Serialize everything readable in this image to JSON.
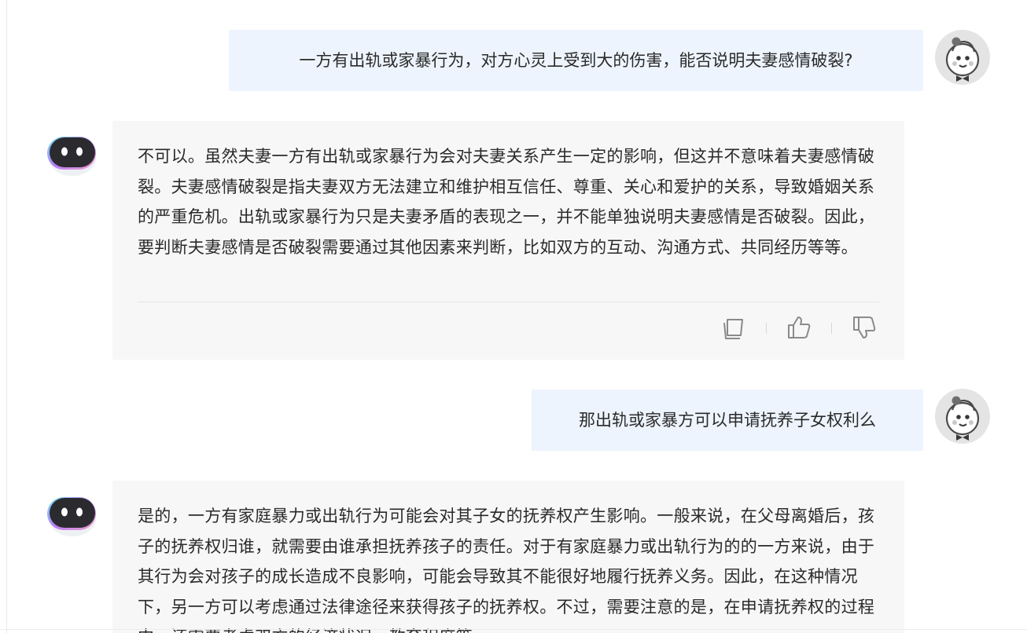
{
  "messages": [
    {
      "role": "user",
      "text": "一方有出轨或家暴行为，对方心灵上受到大的伤害，能否说明夫妻感情破裂?"
    },
    {
      "role": "assistant",
      "text": "不可以。虽然夫妻一方有出轨或家暴行为会对夫妻关系产生一定的影响，但这并不意味着夫妻感情破裂。夫妻感情破裂是指夫妻双方无法建立和维护相互信任、尊重、关心和爱护的关系，导致婚姻关系的严重危机。出轨或家暴行为只是夫妻矛盾的表现之一，并不能单独说明夫妻感情是否破裂。因此，要判断夫妻感情是否破裂需要通过其他因素来判断，比如双方的互动、沟通方式、共同经历等等。",
      "actions": [
        "copy-icon",
        "thumbs-up-icon",
        "thumbs-down-icon"
      ]
    },
    {
      "role": "user",
      "text": "那出轨或家暴方可以申请抚养子女权利么"
    },
    {
      "role": "assistant",
      "text": "是的，一方有家庭暴力或出轨行为可能会对其子女的抚养权产生影响。一般来说，在父母离婚后，孩子的抚养权归谁，就需要由谁承担抚养孩子的责任。对于有家庭暴力或出轨行为的的一方来说，由于其行为会对孩子的成长造成不良影响，可能会导致其不能很好地履行抚养义务。因此，在这种情况下，另一方可以考虑通过法律途径来获得孩子的抚养权。不过，需要注意的是，在申请抚养权的过程中，还需要考虑双方的经济状况、教育程度等"
    }
  ],
  "colors": {
    "user_bubble": "#edf4fd",
    "assistant_bubble": "#f7f7f8",
    "text": "#2a2a2a"
  }
}
